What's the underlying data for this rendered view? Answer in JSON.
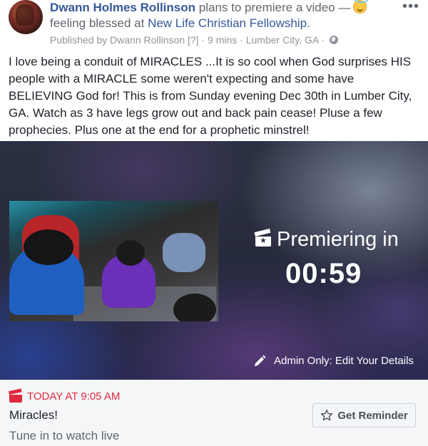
{
  "header": {
    "author": "Dwann Holmes Rollinson",
    "action": "plans to premiere a video —",
    "feeling": "feeling blessed at",
    "place": "New Life Christian Fellowship",
    "place_suffix": ".",
    "published_by": "Published by Dwann Rollinson",
    "help": "[?]",
    "time": "9 mins",
    "location": "Lumber City, GA",
    "dot": "·",
    "more": "•••",
    "emoji_icon": "smiling-halo-face-icon",
    "privacy_icon": "globe-icon"
  },
  "post_text": "I love being a conduit of MIRACLES ...It is so cool when God surprises HIS people with a MIRACLE some weren't expecting and some have BELIEVING God for! This is from Sunday evening Dec 30th in Lumber City, GA. Watch as 3 have legs grow out and back pain cease! Pluse a few prophecies. Plus one at the end for a prophetic minstrel!",
  "video": {
    "premiere_label": "Premiering in",
    "countdown": "00:59",
    "admin_label": "Admin Only: Edit Your Details",
    "premiere_icon": "clapperboard-star-icon",
    "edit_icon": "pencil-icon"
  },
  "event": {
    "date": "TODAY AT 9:05 AM",
    "title": "Miracles!",
    "subtitle": "Tune in to watch live",
    "reminder_label": "Get Reminder",
    "calendar_icon": "clapperboard-icon",
    "reminder_icon": "star-outline-icon",
    "accent_color": "#e02a3e",
    "link_color": "#365899"
  }
}
